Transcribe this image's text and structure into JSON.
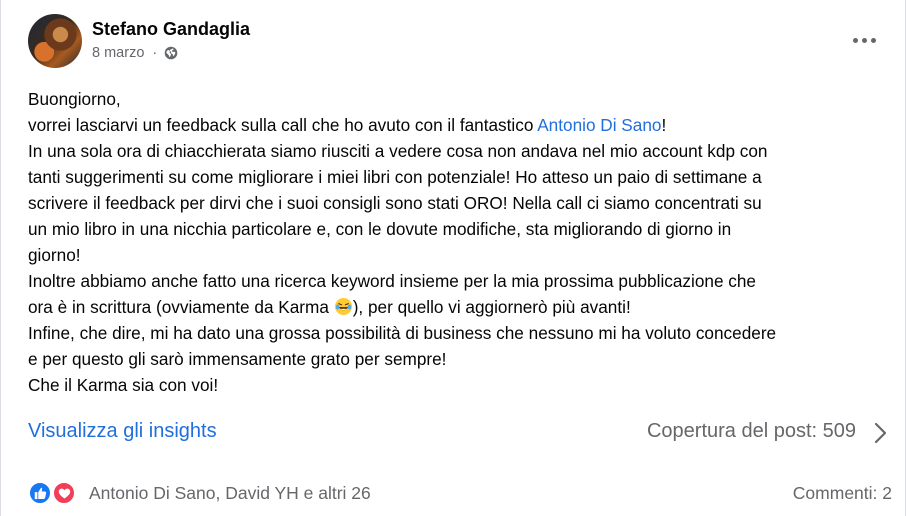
{
  "post": {
    "author": "Stefano Gandaglia",
    "date": "8 marzo",
    "date_separator": "·",
    "audience_icon": "globe-icon",
    "lines": [
      [
        {
          "text": "Buongiorno,"
        }
      ],
      [
        {
          "text": "vorrei lasciarvi un feedback sulla call che ho avuto con il fantastico "
        },
        {
          "text": "Antonio Di Sano",
          "mention": true
        },
        {
          "text": "!"
        }
      ],
      [
        {
          "text": "In una sola ora di chiacchierata siamo riusciti a vedere cosa non andava nel mio account kdp con"
        }
      ],
      [
        {
          "text": "tanti suggerimenti su come migliorare i miei libri con potenziale! Ho atteso un paio di settimane a"
        }
      ],
      [
        {
          "text": "scrivere il feedback per dirvi che i suoi consigli sono stati ORO! Nella call ci siamo concentrati su"
        }
      ],
      [
        {
          "text": "un mio libro in una nicchia particolare e, con le dovute modifiche, sta migliorando di giorno in"
        }
      ],
      [
        {
          "text": "giorno!"
        }
      ],
      [
        {
          "text": "Inoltre abbiamo anche fatto una ricerca keyword insieme per la mia prossima pubblicazione che"
        }
      ],
      [
        {
          "text": "ora è in scrittura (ovviamente da Karma "
        },
        {
          "emoji": "laughing-tears-emoji"
        },
        {
          "text": "), per quello vi aggiornerò più avanti!"
        }
      ],
      [
        {
          "text": "Infine, che dire, mi ha dato una grossa possibilità di business che nessuno mi ha voluto concedere"
        }
      ],
      [
        {
          "text": "e per questo gli sarò immensamente grato per sempre!"
        }
      ],
      [
        {
          "text": "Che il Karma sia con voi!"
        }
      ]
    ]
  },
  "insights": {
    "link_label": "Visualizza gli insights",
    "reach_label": "Copertura del post: 509"
  },
  "reactions": {
    "icons": [
      "like-icon",
      "love-icon"
    ],
    "summary": "Antonio Di Sano, David YH e altri 26",
    "comments_label": "Commenti: 2"
  },
  "colors": {
    "link": "#216fdb",
    "secondary_text": "#65676b",
    "like": "#1877f2",
    "love": "#f33e58"
  }
}
